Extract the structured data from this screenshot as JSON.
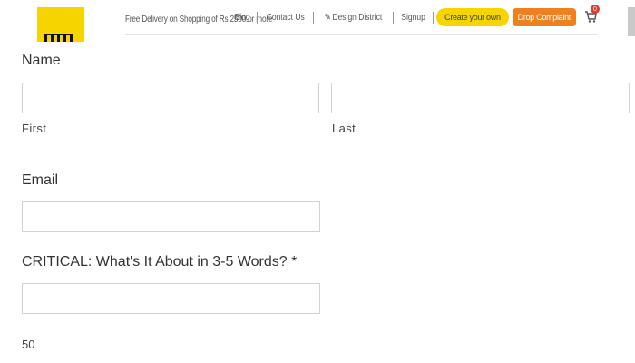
{
  "header": {
    "tagline": "Free Delivery on Shopping of Rs 2500 or more",
    "nav": {
      "blog": "Blog",
      "contact": "Contact Us",
      "design_district": "Design District",
      "signup": "Signup",
      "create_your_own": "Create your own",
      "drop_complaint": "Drop Complaint",
      "cart_count": "0"
    },
    "icons": {
      "logo": "brand-logo",
      "pencil": "pencil-icon",
      "cart": "cart-icon"
    },
    "colors": {
      "brand_yellow": "#f6d400",
      "complaint_orange": "#f07f1e",
      "badge_red": "#e23b2e"
    }
  },
  "form": {
    "name": {
      "label": "Name",
      "first": {
        "value": "",
        "sublabel": "First"
      },
      "last": {
        "value": "",
        "sublabel": "Last"
      }
    },
    "email": {
      "label": "Email",
      "value": ""
    },
    "critical": {
      "label": "CRITICAL: What's It About in 3-5 Words?",
      "required_mark": "*",
      "value": "",
      "char_count": "50"
    }
  }
}
